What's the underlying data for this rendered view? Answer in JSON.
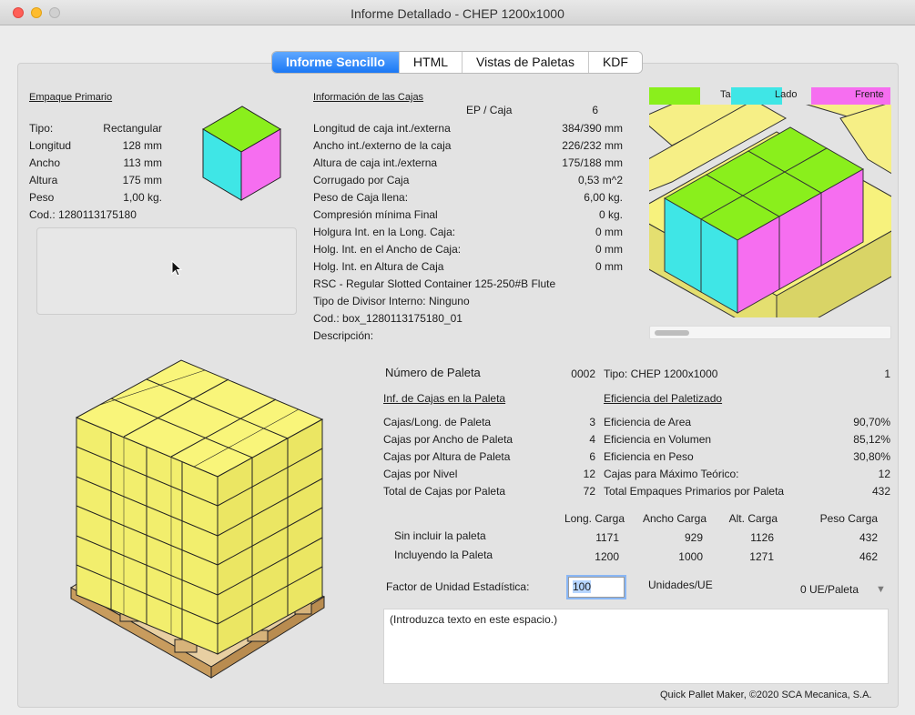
{
  "window": {
    "title": "Informe Detallado - CHEP 1200x1000"
  },
  "tabs": [
    "Informe Sencillo",
    "HTML",
    "Vistas de Paletas",
    "KDF"
  ],
  "primary": {
    "heading": "Empaque Primario",
    "rows": [
      {
        "label": "Tipo:",
        "value": "Rectangular"
      },
      {
        "label": "Longitud",
        "value": "128 mm"
      },
      {
        "label": "Ancho",
        "value": "113 mm"
      },
      {
        "label": "Altura",
        "value": "175 mm"
      },
      {
        "label": "Peso",
        "value": "1,00 kg."
      }
    ],
    "code": "Cod.: 1280113175180"
  },
  "boxes": {
    "heading": "Información de las Cajas",
    "ep_label": "EP / Caja",
    "ep_value": "6",
    "rows": [
      {
        "label": "Longitud de caja int./externa",
        "value": "384/390 mm"
      },
      {
        "label": "Ancho int./externo de la caja",
        "value": "226/232 mm"
      },
      {
        "label": "Altura de caja int./externa",
        "value": "175/188 mm"
      },
      {
        "label": "Corrugado por Caja",
        "value": "0,53 m^2"
      },
      {
        "label": "Peso de Caja llena:",
        "value": "6,00 kg."
      },
      {
        "label": "Compresión mínima Final",
        "value": "0 kg."
      },
      {
        "label": "Holgura Int. en la Long. Caja:",
        "value": "0 mm"
      },
      {
        "label": "Holg. Int. en el Ancho de Caja:",
        "value": "0 mm"
      },
      {
        "label": "Holg. Int. en Altura de Caja",
        "value": "0 mm"
      }
    ],
    "rsc": "RSC - Regular Slotted Container 125-250#B Flute",
    "divider": "Tipo de Divisor Interno: Ninguno",
    "code": "Cod.: box_1280113175180_01",
    "description": "Descripción:"
  },
  "legend": [
    {
      "label": "Tapa",
      "color": "#8aef1c"
    },
    {
      "label": "Lado",
      "color": "#3fe6e6"
    },
    {
      "label": "Frente",
      "color": "#f66ef0"
    }
  ],
  "pallet": {
    "num_label": "Número de Paleta",
    "num_value": "0002",
    "type": "Tipo: CHEP 1200x1000",
    "type_count": "1",
    "left_heading": "Inf. de Cajas en la Paleta",
    "right_heading": "Eficiencia del Paletizado",
    "left_rows": [
      {
        "label": "Cajas/Long. de Paleta",
        "value": "3"
      },
      {
        "label": "Cajas por Ancho de Paleta",
        "value": "4"
      },
      {
        "label": "Cajas por Altura de Paleta",
        "value": "6"
      },
      {
        "label": "Cajas por Nivel",
        "value": "12"
      },
      {
        "label": "Total de Cajas por Paleta",
        "value": "72"
      }
    ],
    "right_rows": [
      {
        "label": "Eficiencia de Area",
        "value": "90,70%"
      },
      {
        "label": "Eficiencia en Volumen",
        "value": "85,12%"
      },
      {
        "label": "Eficiencia en Peso",
        "value": "30,80%"
      },
      {
        "label": "Cajas para Máximo Teórico:",
        "value": "12"
      },
      {
        "label": "Total Empaques Primarios por Paleta",
        "value": "432"
      }
    ]
  },
  "load": {
    "headers": [
      "Long. Carga",
      "Ancho Carga",
      "Alt. Carga",
      "Peso Carga"
    ],
    "rows": [
      {
        "label": "Sin incluir la paleta",
        "values": [
          "1171",
          "929",
          "1126",
          "432"
        ]
      },
      {
        "label": "Incluyendo la Paleta",
        "values": [
          "1200",
          "1000",
          "1271",
          "462"
        ]
      }
    ]
  },
  "factor": {
    "label": "Factor de Unidad Estadística:",
    "value": "100",
    "units_label": "Unidades/UE",
    "units_value": "0 UE/Paleta"
  },
  "notes": {
    "placeholder": "(Introduzca texto en este espacio.)"
  },
  "footer": "Quick Pallet Maker, ©2020 SCA Mecanica, S.A."
}
